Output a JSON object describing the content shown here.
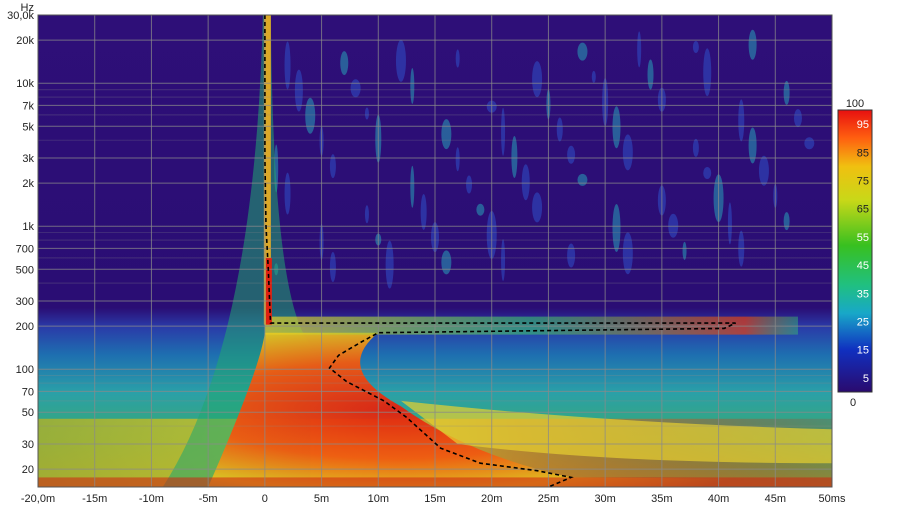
{
  "chart_data": {
    "type": "heatmap",
    "y_unit": "Hz",
    "x_unit_label": "ms",
    "y_scale": "log",
    "x_range_ms": [
      -20,
      50
    ],
    "y_range_hz": [
      15,
      30000
    ],
    "x_ticks": [
      {
        "value": -20,
        "label": "-20,0m"
      },
      {
        "value": -15,
        "label": "-15m"
      },
      {
        "value": -10,
        "label": "-10m"
      },
      {
        "value": -5,
        "label": "-5m"
      },
      {
        "value": 0,
        "label": "0"
      },
      {
        "value": 5,
        "label": "5m"
      },
      {
        "value": 10,
        "label": "10m"
      },
      {
        "value": 15,
        "label": "15m"
      },
      {
        "value": 20,
        "label": "20m"
      },
      {
        "value": 25,
        "label": "25m"
      },
      {
        "value": 30,
        "label": "30m"
      },
      {
        "value": 35,
        "label": "35m"
      },
      {
        "value": 40,
        "label": "40m"
      },
      {
        "value": 45,
        "label": "45m"
      },
      {
        "value": 50,
        "label": "50ms"
      }
    ],
    "y_ticks": [
      {
        "value": 30000,
        "label": "30,0k"
      },
      {
        "value": 20000,
        "label": "20k"
      },
      {
        "value": 10000,
        "label": "10k"
      },
      {
        "value": 7000,
        "label": "7k"
      },
      {
        "value": 5000,
        "label": "5k"
      },
      {
        "value": 3000,
        "label": "3k"
      },
      {
        "value": 2000,
        "label": "2k"
      },
      {
        "value": 1000,
        "label": "1k"
      },
      {
        "value": 700,
        "label": "700"
      },
      {
        "value": 500,
        "label": "500"
      },
      {
        "value": 300,
        "label": "300"
      },
      {
        "value": 200,
        "label": "200"
      },
      {
        "value": 100,
        "label": "100"
      },
      {
        "value": 70,
        "label": "70"
      },
      {
        "value": 50,
        "label": "50"
      },
      {
        "value": 30,
        "label": "30"
      },
      {
        "value": 20,
        "label": "20"
      }
    ],
    "minor_gridlines_hz": [
      40,
      60,
      80,
      90,
      400,
      600,
      800,
      900,
      4000,
      6000,
      8000,
      9000
    ],
    "grid": true,
    "colorbar": {
      "min": 0,
      "max": 100,
      "min_label": "0",
      "max_label": "100",
      "ticks": [
        5,
        15,
        25,
        35,
        45,
        55,
        65,
        75,
        85,
        95
      ],
      "colors": [
        "#2a0a6e",
        "#1030c0",
        "#18a8c8",
        "#20c080",
        "#38c020",
        "#c8d818",
        "#f0c010",
        "#ff6010",
        "#e81010"
      ]
    },
    "ridge_contour": [
      {
        "t": 0.0,
        "f": 30000
      },
      {
        "t": 0.0,
        "f": 3000
      },
      {
        "t": 0.1,
        "f": 1000
      },
      {
        "t": 0.3,
        "f": 500
      },
      {
        "t": 0.5,
        "f": 210
      },
      {
        "t": 41.5,
        "f": 210
      },
      {
        "t": 40.5,
        "f": 193
      },
      {
        "t": 10,
        "f": 180
      },
      {
        "t": 8.5,
        "f": 155
      },
      {
        "t": 6.5,
        "f": 125
      },
      {
        "t": 5.7,
        "f": 102
      },
      {
        "t": 7.2,
        "f": 82
      },
      {
        "t": 10.5,
        "f": 60
      },
      {
        "t": 12.5,
        "f": 46
      },
      {
        "t": 15.5,
        "f": 28
      },
      {
        "t": 19,
        "f": 22
      },
      {
        "t": 24,
        "f": 19.5
      },
      {
        "t": 27,
        "f": 17.5
      },
      {
        "t": 25,
        "f": 15
      }
    ]
  }
}
